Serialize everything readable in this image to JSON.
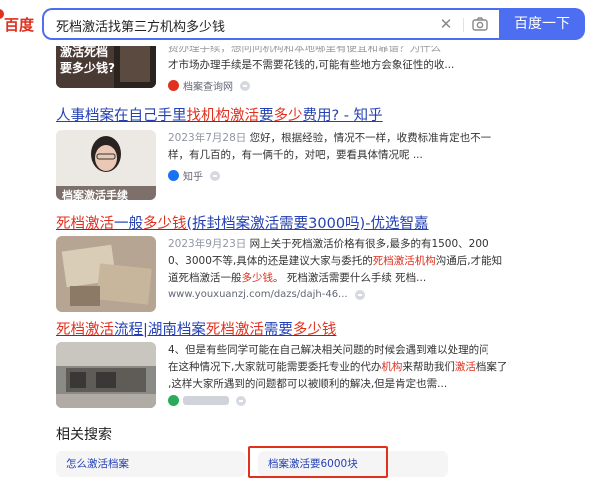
{
  "header": {
    "logo_text": "百度",
    "search_value": "死档激活找第三方机构多少钱",
    "clear_symbol": "✕",
    "search_button": "百度一下"
  },
  "results": [
    {
      "title_parts": [],
      "snippet_line1": "费办理手续，想问问机构和本地哪里有便宜和靠谱？为什么",
      "snippet_line2": "才市场办理手续是不需要花钱的,可能有些地方会象征性的收...",
      "thumb_caption": "激活死档要多少钱?",
      "source": "档案查询网"
    },
    {
      "title_parts": [
        {
          "text": "人事档案在自己手里",
          "hl": false
        },
        {
          "text": "找机构激活",
          "hl": true
        },
        {
          "text": "要",
          "hl": false
        },
        {
          "text": "多少",
          "hl": true
        },
        {
          "text": "费用? - 知乎",
          "hl": false
        }
      ],
      "date": "2023年7月28日",
      "snippet_line1_rest": "您好，根据经验，情况不一样，收费标准肯定也不一",
      "snippet_line2": "样，有几百的，有一俩千的，对吧，要看具体情况呢 ...",
      "thumb_caption": "档案激活手续",
      "source": "知乎"
    },
    {
      "title_parts": [
        {
          "text": "死档激活",
          "hl": true
        },
        {
          "text": "一般",
          "hl": false
        },
        {
          "text": "多少钱",
          "hl": true
        },
        {
          "text": "(拆封档案激活需要3000吗)-优选智嘉",
          "hl": false
        }
      ],
      "date": "2023年9月23日",
      "snippet_line1_rest": "网上关于死档激活价格有很多,最多的有1500、200",
      "snippet_line2": "0、3000不等,具体的还是建议大家与委托的",
      "snippet_line2_hl": "死档激活机构",
      "snippet_line2_end": "沟通后,才能知",
      "snippet_line3_a": "道死档激活一般",
      "snippet_line3_hl": "多少钱",
      "snippet_line3_b": "。    死档激活需要什么手续      死档...",
      "source": "www.youxuanzj.com/dazs/dajh-46..."
    },
    {
      "title_parts": [
        {
          "text": "死档激活",
          "hl": true
        },
        {
          "text": "流程|湖南档案",
          "hl": false
        },
        {
          "text": "死档激活",
          "hl": true
        },
        {
          "text": "需要",
          "hl": false
        },
        {
          "text": "多少钱",
          "hl": true
        }
      ],
      "snippet_line1": "4、但是有些同学可能在自己解决相关问题的时候会遇到难以处理的问题,",
      "snippet_line2": "在这种情况下,大家就可能需要委托专业的代办",
      "snippet_line2_hl": "机构",
      "snippet_line2_mid": "来帮助我们",
      "snippet_line2_hl2": "激活",
      "snippet_line2_end": "档案了",
      "snippet_line3": ",这样大家所遇到的问题都可以被顺利的解决,但是肯定也需...",
      "source": ""
    }
  ],
  "related": {
    "title": "相关搜索",
    "items": [
      "怎么激活档案",
      "档案激活要6000块"
    ]
  },
  "colors": {
    "accent": "#4e6ef2",
    "highlight_red": "#e0301e",
    "link_blue": "#2440b3"
  }
}
